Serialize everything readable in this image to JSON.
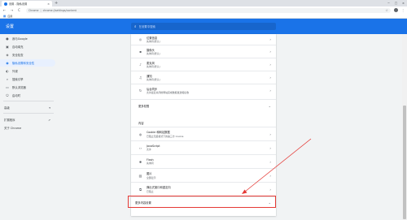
{
  "browser": {
    "tab_title": "设置 - 隐私设置",
    "tab_close": "×",
    "new_tab": "+",
    "window_controls": [
      "−",
      "□",
      "×"
    ],
    "back": "←",
    "forward": "→",
    "reload": "C",
    "url_prefix": "Chrome",
    "url_sep": "|",
    "url_path": "chrome://settings/content",
    "bookmark_apps": "应用",
    "star": "☆",
    "menu": "⋮"
  },
  "header": {
    "title": "设置",
    "search_placeholder": "在设置中搜索"
  },
  "sidebar": {
    "items": [
      {
        "icon": "person-icon",
        "glyph": "●",
        "label": "我与Google"
      },
      {
        "icon": "autofill-icon",
        "glyph": "▣",
        "label": "自动填充"
      },
      {
        "icon": "shield-icon",
        "glyph": "◈",
        "label": "安全检查"
      },
      {
        "icon": "privacy-icon",
        "glyph": "◉",
        "label": "隐私设置和安全性"
      },
      {
        "icon": "palette-icon",
        "glyph": "◐",
        "label": "外观"
      },
      {
        "icon": "search-icon",
        "glyph": "⌕",
        "label": "搜索引擎"
      },
      {
        "icon": "browser-icon",
        "glyph": "▭",
        "label": "默认浏览器"
      },
      {
        "icon": "power-icon",
        "glyph": "⏻",
        "label": "启动时"
      }
    ],
    "advanced": "高级",
    "extensions": "扩展程序",
    "about": "关于 Chrome"
  },
  "main": {
    "top_rows": [
      {
        "icon": "location-icon",
        "glyph": "◎",
        "title": "位置信息",
        "sub": "先询问(默认)"
      },
      {
        "icon": "camera-icon",
        "glyph": "▪",
        "title": "摄像头",
        "sub": "先询问(默认)"
      },
      {
        "icon": "mic-icon",
        "glyph": "♪",
        "title": "麦克风",
        "sub": "先询问(默认)"
      },
      {
        "icon": "bell-icon",
        "glyph": "♫",
        "title": "通知",
        "sub": "先询问(默认)"
      },
      {
        "icon": "sync-icon",
        "glyph": "↻",
        "title": "后台同步",
        "sub": "允许最近关闭的网站完成数据发送和接收"
      }
    ],
    "more_permissions": "更多权限",
    "content_section": "内容",
    "content_rows": [
      {
        "icon": "cookie-icon",
        "glyph": "◍",
        "title": "Cookie 和网站数据",
        "sub": "已阻止无痕模式下的第三方 Cookie"
      },
      {
        "icon": "code-icon",
        "glyph": "‹›",
        "title": "JavaScript",
        "sub": "允许"
      },
      {
        "icon": "puzzle-icon",
        "glyph": "✱",
        "title": "Flash",
        "sub": "先询问"
      },
      {
        "icon": "image-icon",
        "glyph": "▨",
        "title": "图片",
        "sub": "全部显示"
      },
      {
        "icon": "popup-icon",
        "glyph": "⧉",
        "title": "弹出式窗口和重定向",
        "sub": "已阻止"
      }
    ],
    "more_content": "更多内容设置",
    "arrow": "›",
    "chevron": "⌄"
  }
}
